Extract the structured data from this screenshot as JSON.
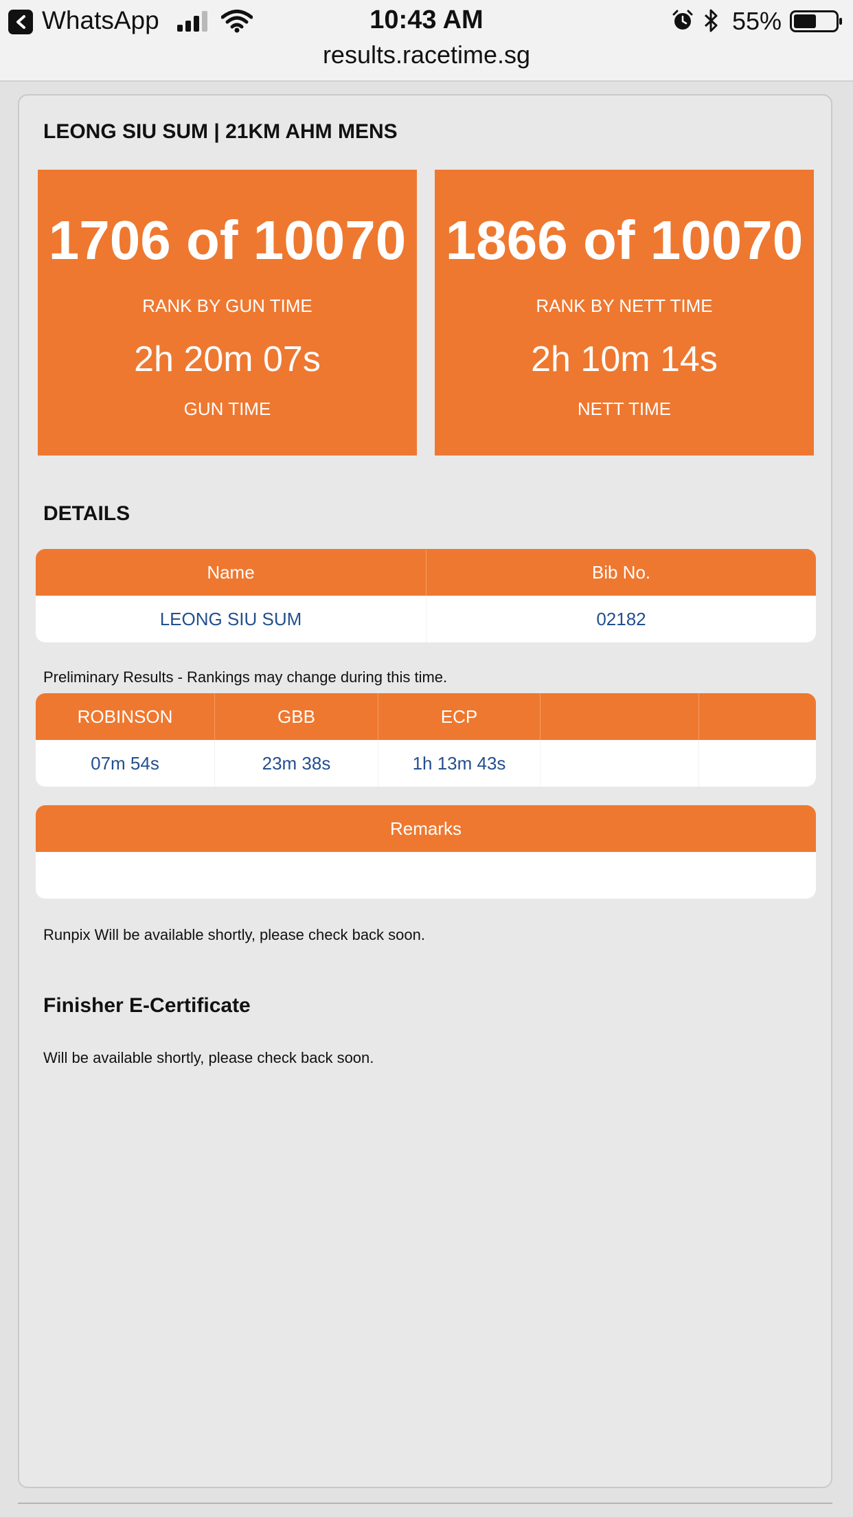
{
  "status_bar": {
    "back_app": "WhatsApp",
    "time": "10:43 AM",
    "battery_percent": "55%",
    "battery_level": 0.55
  },
  "browser": {
    "url": "results.racetime.sg"
  },
  "runner": {
    "headline": "LEONG SIU SUM | 21KM AHM MENS"
  },
  "gun": {
    "rank": "1706 of 10070",
    "rank_label": "RANK BY GUN TIME",
    "time": "2h 20m 07s",
    "time_label": "GUN TIME"
  },
  "nett": {
    "rank": "1866 of 10070",
    "rank_label": "RANK BY NETT TIME",
    "time": "2h 10m 14s",
    "time_label": "NETT TIME"
  },
  "details": {
    "title": "DETAILS",
    "headers": [
      "Name",
      "Bib No."
    ],
    "values": [
      "LEONG SIU SUM",
      "02182"
    ]
  },
  "splits": {
    "note": "Preliminary Results - Rankings may change during this time.",
    "headers": [
      "ROBINSON",
      "GBB",
      "ECP",
      "",
      ""
    ],
    "values": [
      "07m 54s",
      "23m 38s",
      "1h 13m 43s",
      "",
      ""
    ]
  },
  "remarks": {
    "header": "Remarks",
    "value": ""
  },
  "runpix": {
    "note": "Runpix Will be available shortly, please check back soon."
  },
  "certificate": {
    "title": "Finisher E-Certificate",
    "note": "Will be available shortly, please check back soon."
  },
  "colors": {
    "accent": "#ee7830",
    "link": "#234f8e",
    "card_bg": "#e8e8e8"
  }
}
